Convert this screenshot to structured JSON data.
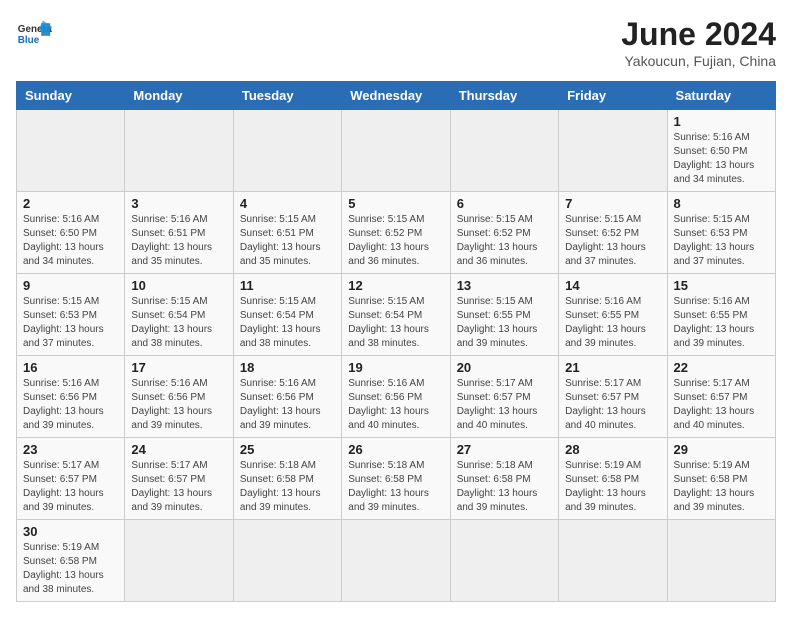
{
  "header": {
    "logo_text_general": "General",
    "logo_text_blue": "Blue",
    "title": "June 2024",
    "subtitle": "Yakoucun, Fujian, China"
  },
  "weekdays": [
    "Sunday",
    "Monday",
    "Tuesday",
    "Wednesday",
    "Thursday",
    "Friday",
    "Saturday"
  ],
  "weeks": [
    [
      {
        "day": "",
        "detail": ""
      },
      {
        "day": "",
        "detail": ""
      },
      {
        "day": "",
        "detail": ""
      },
      {
        "day": "",
        "detail": ""
      },
      {
        "day": "",
        "detail": ""
      },
      {
        "day": "",
        "detail": ""
      },
      {
        "day": "1",
        "detail": "Sunrise: 5:16 AM\nSunset: 6:50 PM\nDaylight: 13 hours\nand 34 minutes."
      }
    ],
    [
      {
        "day": "2",
        "detail": "Sunrise: 5:16 AM\nSunset: 6:50 PM\nDaylight: 13 hours\nand 34 minutes."
      },
      {
        "day": "3",
        "detail": "Sunrise: 5:16 AM\nSunset: 6:51 PM\nDaylight: 13 hours\nand 35 minutes."
      },
      {
        "day": "4",
        "detail": "Sunrise: 5:15 AM\nSunset: 6:51 PM\nDaylight: 13 hours\nand 35 minutes."
      },
      {
        "day": "5",
        "detail": "Sunrise: 5:15 AM\nSunset: 6:52 PM\nDaylight: 13 hours\nand 36 minutes."
      },
      {
        "day": "6",
        "detail": "Sunrise: 5:15 AM\nSunset: 6:52 PM\nDaylight: 13 hours\nand 36 minutes."
      },
      {
        "day": "7",
        "detail": "Sunrise: 5:15 AM\nSunset: 6:52 PM\nDaylight: 13 hours\nand 37 minutes."
      },
      {
        "day": "8",
        "detail": "Sunrise: 5:15 AM\nSunset: 6:53 PM\nDaylight: 13 hours\nand 37 minutes."
      }
    ],
    [
      {
        "day": "9",
        "detail": "Sunrise: 5:15 AM\nSunset: 6:53 PM\nDaylight: 13 hours\nand 37 minutes."
      },
      {
        "day": "10",
        "detail": "Sunrise: 5:15 AM\nSunset: 6:54 PM\nDaylight: 13 hours\nand 38 minutes."
      },
      {
        "day": "11",
        "detail": "Sunrise: 5:15 AM\nSunset: 6:54 PM\nDaylight: 13 hours\nand 38 minutes."
      },
      {
        "day": "12",
        "detail": "Sunrise: 5:15 AM\nSunset: 6:54 PM\nDaylight: 13 hours\nand 38 minutes."
      },
      {
        "day": "13",
        "detail": "Sunrise: 5:15 AM\nSunset: 6:55 PM\nDaylight: 13 hours\nand 39 minutes."
      },
      {
        "day": "14",
        "detail": "Sunrise: 5:16 AM\nSunset: 6:55 PM\nDaylight: 13 hours\nand 39 minutes."
      },
      {
        "day": "15",
        "detail": "Sunrise: 5:16 AM\nSunset: 6:55 PM\nDaylight: 13 hours\nand 39 minutes."
      }
    ],
    [
      {
        "day": "16",
        "detail": "Sunrise: 5:16 AM\nSunset: 6:56 PM\nDaylight: 13 hours\nand 39 minutes."
      },
      {
        "day": "17",
        "detail": "Sunrise: 5:16 AM\nSunset: 6:56 PM\nDaylight: 13 hours\nand 39 minutes."
      },
      {
        "day": "18",
        "detail": "Sunrise: 5:16 AM\nSunset: 6:56 PM\nDaylight: 13 hours\nand 39 minutes."
      },
      {
        "day": "19",
        "detail": "Sunrise: 5:16 AM\nSunset: 6:56 PM\nDaylight: 13 hours\nand 40 minutes."
      },
      {
        "day": "20",
        "detail": "Sunrise: 5:17 AM\nSunset: 6:57 PM\nDaylight: 13 hours\nand 40 minutes."
      },
      {
        "day": "21",
        "detail": "Sunrise: 5:17 AM\nSunset: 6:57 PM\nDaylight: 13 hours\nand 40 minutes."
      },
      {
        "day": "22",
        "detail": "Sunrise: 5:17 AM\nSunset: 6:57 PM\nDaylight: 13 hours\nand 40 minutes."
      }
    ],
    [
      {
        "day": "23",
        "detail": "Sunrise: 5:17 AM\nSunset: 6:57 PM\nDaylight: 13 hours\nand 39 minutes."
      },
      {
        "day": "24",
        "detail": "Sunrise: 5:17 AM\nSunset: 6:57 PM\nDaylight: 13 hours\nand 39 minutes."
      },
      {
        "day": "25",
        "detail": "Sunrise: 5:18 AM\nSunset: 6:58 PM\nDaylight: 13 hours\nand 39 minutes."
      },
      {
        "day": "26",
        "detail": "Sunrise: 5:18 AM\nSunset: 6:58 PM\nDaylight: 13 hours\nand 39 minutes."
      },
      {
        "day": "27",
        "detail": "Sunrise: 5:18 AM\nSunset: 6:58 PM\nDaylight: 13 hours\nand 39 minutes."
      },
      {
        "day": "28",
        "detail": "Sunrise: 5:19 AM\nSunset: 6:58 PM\nDaylight: 13 hours\nand 39 minutes."
      },
      {
        "day": "29",
        "detail": "Sunrise: 5:19 AM\nSunset: 6:58 PM\nDaylight: 13 hours\nand 39 minutes."
      }
    ],
    [
      {
        "day": "30",
        "detail": "Sunrise: 5:19 AM\nSunset: 6:58 PM\nDaylight: 13 hours\nand 38 minutes."
      },
      {
        "day": "",
        "detail": ""
      },
      {
        "day": "",
        "detail": ""
      },
      {
        "day": "",
        "detail": ""
      },
      {
        "day": "",
        "detail": ""
      },
      {
        "day": "",
        "detail": ""
      },
      {
        "day": "",
        "detail": ""
      }
    ]
  ]
}
